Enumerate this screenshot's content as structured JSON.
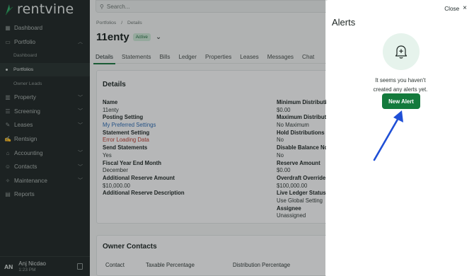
{
  "sidebar": {
    "logo_text": "rentvine",
    "items": [
      {
        "label": "Dashboard",
        "icon": "grid-icon",
        "chevron": false
      },
      {
        "label": "Portfolio",
        "icon": "folder-icon",
        "chevron": true
      }
    ],
    "sub_items": [
      {
        "label": "Dashboard",
        "active": false
      },
      {
        "label": "Portfolios",
        "active": true
      },
      {
        "label": "Owner Leads",
        "active": false
      }
    ],
    "items_after": [
      {
        "label": "Property",
        "icon": "building-icon",
        "chevron": true
      },
      {
        "label": "Screening",
        "icon": "screening-icon",
        "chevron": true
      },
      {
        "label": "Leases",
        "icon": "lease-icon",
        "chevron": true
      },
      {
        "label": "Rentsign",
        "icon": "sign-icon",
        "chevron": false
      },
      {
        "label": "Accounting",
        "icon": "bank-icon",
        "chevron": true
      },
      {
        "label": "Contacts",
        "icon": "contacts-icon",
        "chevron": true
      },
      {
        "label": "Maintenance",
        "icon": "wrench-icon",
        "chevron": true
      },
      {
        "label": "Reports",
        "icon": "chart-icon",
        "chevron": false
      }
    ],
    "user": {
      "initials": "AN",
      "name": "Anj Nicdao",
      "time": "1:23 PM"
    }
  },
  "search": {
    "placeholder": "Search..."
  },
  "breadcrumb": [
    "Portfolios",
    "/",
    "Details"
  ],
  "page": {
    "title": "11enty",
    "status": "Active"
  },
  "tabs": [
    "Details",
    "Statements",
    "Bills",
    "Ledger",
    "Properties",
    "Leases",
    "Messages",
    "Chat"
  ],
  "details": {
    "title": "Details",
    "left": [
      {
        "label": "Name",
        "value": "11enty",
        "style": "normal"
      },
      {
        "label": "Posting Setting",
        "value": "My Preferred Settings",
        "style": "link"
      },
      {
        "label": "Statement Setting",
        "value": "Error Loading Data",
        "style": "error"
      },
      {
        "label": "Send Statements",
        "value": "Yes",
        "style": "normal"
      },
      {
        "label": "Fiscal Year End Month",
        "value": "December",
        "style": "normal"
      },
      {
        "label": "Additional Reserve Amount",
        "value": "$10,000.00",
        "style": "normal"
      },
      {
        "label": "Additional Reserve Description",
        "value": "",
        "style": "normal"
      }
    ],
    "right": [
      {
        "label": "Minimum Distributi",
        "value": "$0.00"
      },
      {
        "label": "Maximum Distributi",
        "value": "No Maximum"
      },
      {
        "label": "Hold Distributions",
        "value": "No"
      },
      {
        "label": "Disable Balance No",
        "value": "No"
      },
      {
        "label": "Reserve Amount",
        "value": "$0.00"
      },
      {
        "label": "Overdraft Override",
        "value": "$100,000.00"
      },
      {
        "label": "Live Ledger Status",
        "value": "Use Global Setting"
      },
      {
        "label": "Assignee",
        "value": "Unassigned"
      }
    ]
  },
  "owner_contacts": {
    "title": "Owner Contacts",
    "columns": [
      "Contact",
      "Taxable Percentage",
      "Distribution Percentage"
    ]
  },
  "alerts_panel": {
    "close_label": "Close",
    "title": "Alerts",
    "empty_line1": "It seems you haven't",
    "empty_line2": "created any alerts yet.",
    "new_alert_label": "New Alert"
  },
  "colors": {
    "brand_green": "#137a3c",
    "annotation_arrow": "#1f4fd6",
    "sidebar_bg": "#1c2422"
  }
}
